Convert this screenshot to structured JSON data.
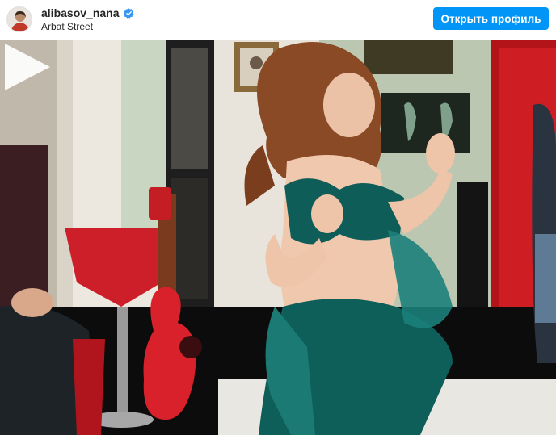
{
  "post_header": {
    "username": "alibasov_nana",
    "verified": true,
    "verified_icon": "verified-badge-icon",
    "location": "Arbat Street",
    "profile_button_label": "Открыть профиль",
    "accent_color": "#0095f6"
  },
  "media": {
    "type": "video",
    "play_icon": "play-icon"
  }
}
